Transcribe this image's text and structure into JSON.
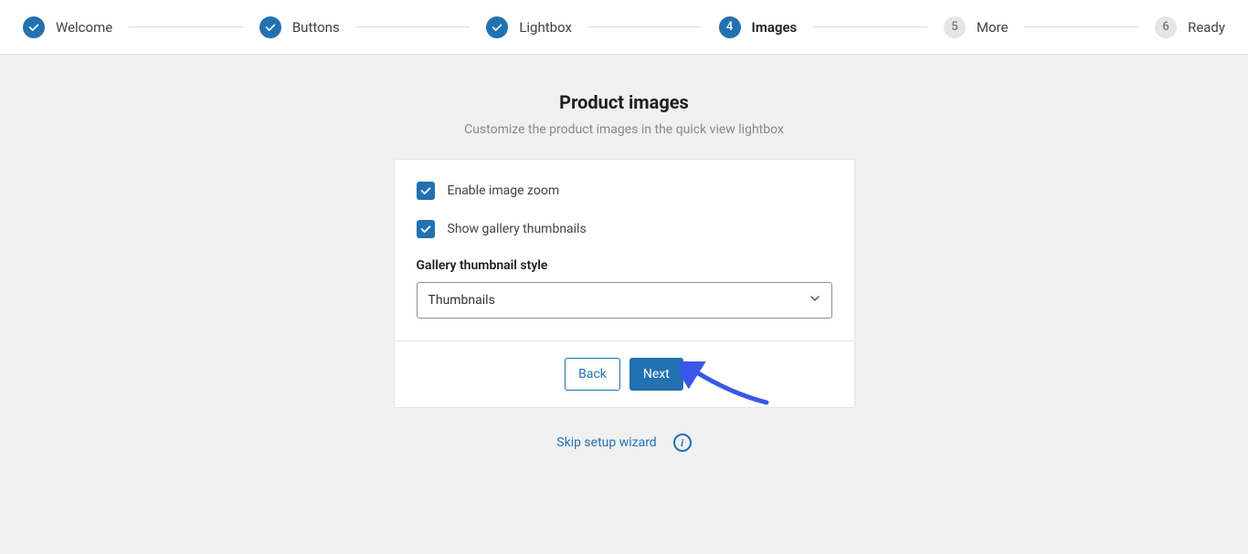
{
  "stepper": {
    "steps": [
      {
        "label": "Welcome",
        "state": "done"
      },
      {
        "label": "Buttons",
        "state": "done"
      },
      {
        "label": "Lightbox",
        "state": "done"
      },
      {
        "label": "Images",
        "state": "active",
        "num": "4"
      },
      {
        "label": "More",
        "state": "pending",
        "num": "5"
      },
      {
        "label": "Ready",
        "state": "pending",
        "num": "6"
      }
    ]
  },
  "page": {
    "title": "Product images",
    "subtitle": "Customize the product images in the quick view lightbox"
  },
  "form": {
    "enable_zoom_label": "Enable image zoom",
    "show_thumbs_label": "Show gallery thumbnails",
    "gallery_style_label": "Gallery thumbnail style",
    "gallery_style_value": "Thumbnails"
  },
  "buttons": {
    "back": "Back",
    "next": "Next"
  },
  "footer": {
    "skip": "Skip setup wizard"
  },
  "colors": {
    "primary": "#2271b1",
    "arrow": "#3858e9"
  }
}
